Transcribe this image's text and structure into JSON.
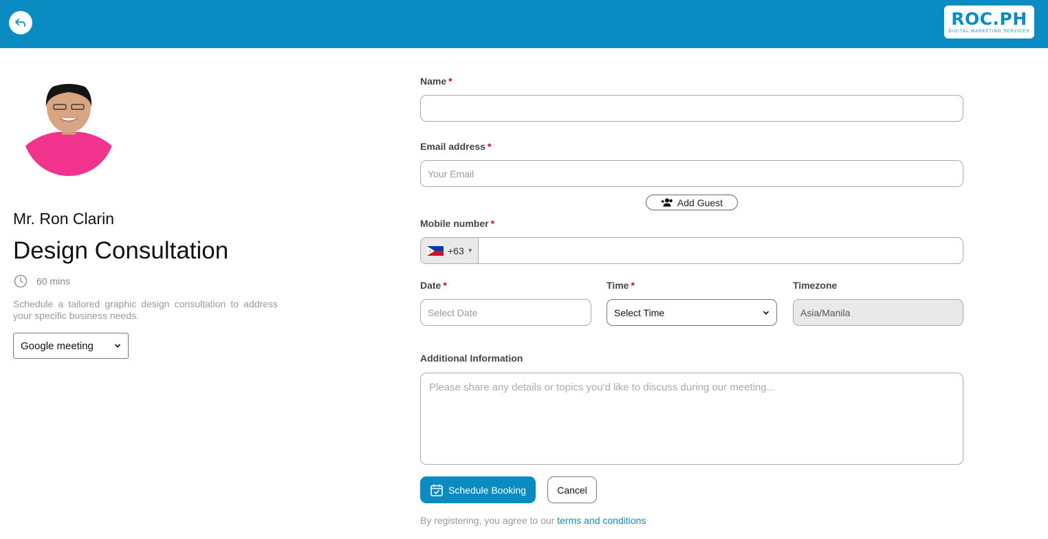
{
  "header": {
    "logo_text": "ROC.PH",
    "logo_subtitle": "DIGITAL MARKETING SERVICES",
    "brand_color": "#0a8cc2"
  },
  "host": {
    "name": "Mr. Ron Clarin",
    "event_title": "Design Consultation",
    "duration": "60 mins",
    "description": "Schedule a tailored graphic design consultation to address your specific business needs.",
    "meeting_type": "Google meeting"
  },
  "form": {
    "name_label": "Name",
    "email_label": "Email address",
    "email_placeholder": "Your Email",
    "add_guest_label": "Add Guest",
    "mobile_label": "Mobile number",
    "country_code": "+63",
    "date_label": "Date",
    "date_placeholder": "Select Date",
    "time_label": "Time",
    "time_value": "Select Time",
    "timezone_label": "Timezone",
    "timezone_value": "Asia/Manila",
    "info_label": "Additional Information",
    "info_placeholder": "Please share any details or topics you'd like to discuss during our meeting...",
    "required_marker": "*"
  },
  "actions": {
    "schedule_label": "Schedule Booking",
    "cancel_label": "Cancel",
    "terms_prefix": "By registering, you agree to our",
    "terms_link": "terms and conditions"
  }
}
